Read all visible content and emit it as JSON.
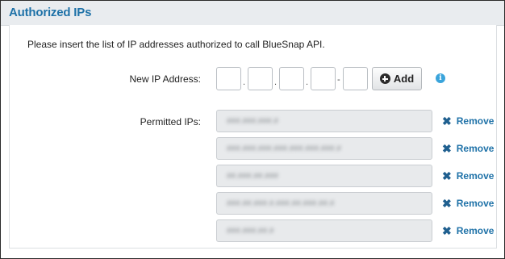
{
  "panel": {
    "title": "Authorized IPs",
    "intro": "Please insert the list of IP addresses authorized to call BlueSnap API."
  },
  "new_ip": {
    "label": "New IP Address:",
    "separators": [
      ".",
      ".",
      ".",
      "-"
    ],
    "add_label": "Add",
    "info_glyph": "i"
  },
  "permitted": {
    "label": "Permitted IPs:",
    "remove_label": "Remove",
    "remove_glyph": "✖",
    "rows": [
      "###.###.###.#",
      "###.###.###.###.###.###.###.#",
      "##.###.##.###",
      "###.##.###.#.###.##.###.##.#",
      "###.###.##.#"
    ]
  },
  "colors": {
    "accent": "#1f72a8",
    "header_bg": "#e9ecef",
    "info_icon": "#3aa4db"
  }
}
